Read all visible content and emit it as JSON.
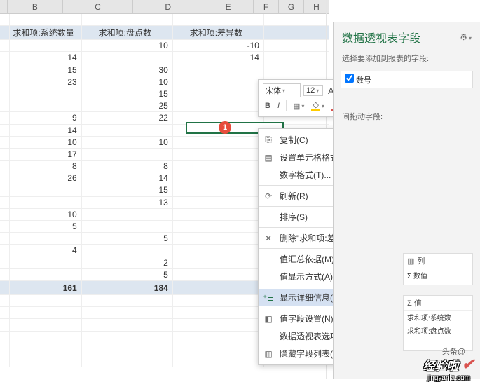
{
  "columns": {
    "B": "B",
    "C": "C",
    "D": "D",
    "E": "E",
    "F": "F",
    "G": "G",
    "H": "H"
  },
  "headers": {
    "b": "求和项:系统数量",
    "c": "求和项:盘点数",
    "d": "求和项:差异数"
  },
  "rows": [
    {
      "b": "",
      "c": "10",
      "d": "-10"
    },
    {
      "b": "14",
      "c": "",
      "d": "14"
    },
    {
      "b": "15",
      "c": "30",
      "d": ""
    },
    {
      "b": "23",
      "c": "10",
      "d": ""
    },
    {
      "b": "",
      "c": "15",
      "d": ""
    },
    {
      "b": "",
      "c": "25",
      "d": ""
    },
    {
      "b": "9",
      "c": "22",
      "d": ""
    },
    {
      "b": "14",
      "c": "",
      "d": ""
    },
    {
      "b": "10",
      "c": "10",
      "d": ""
    },
    {
      "b": "17",
      "c": "",
      "d": ""
    },
    {
      "b": "8",
      "c": "8",
      "d": ""
    },
    {
      "b": "26",
      "c": "14",
      "d": ""
    },
    {
      "b": "",
      "c": "15",
      "d": ""
    },
    {
      "b": "",
      "c": "13",
      "d": ""
    },
    {
      "b": "10",
      "c": "",
      "d": ""
    },
    {
      "b": "5",
      "c": "",
      "d": ""
    },
    {
      "b": "",
      "c": "5",
      "d": ""
    },
    {
      "b": "4",
      "c": "",
      "d": ""
    },
    {
      "b": "",
      "c": "2",
      "d": ""
    },
    {
      "b": "",
      "c": "5",
      "d": ""
    }
  ],
  "totals": {
    "b": "161",
    "c": "184",
    "d": ""
  },
  "mini_toolbar": {
    "font": "宋体",
    "size": "12",
    "bold": "B",
    "italic": "I",
    "percent": "%",
    "comma": ",",
    "a_large": "A",
    "a_small": "A"
  },
  "context": {
    "copy": "复制(C)",
    "format_cells": "设置单元格格式(F)...",
    "number_format": "数字格式(T)...",
    "refresh": "刷新(R)",
    "sort": "排序(S)",
    "delete": "删除\"求和项:差异数\"(V)",
    "summarize": "值汇总依据(M)",
    "show_as": "值显示方式(A)",
    "show_detail": "显示详细信息(E)",
    "field_settings": "值字段设置(N)...",
    "pivot_options": "数据透视表选项(O)...",
    "hide_list": "隐藏字段列表(D)"
  },
  "pane": {
    "title": "数据透视表字段",
    "subtitle": "选择要添加到报表的字段:",
    "checkbox_label": "数号",
    "drag_label": "间拖动字段:",
    "cols_title": "列",
    "cols_item": "Σ 数值",
    "vals_title": "Σ 值",
    "vals_item1": "求和项:系统数",
    "vals_item2": "求和项:盘点数"
  },
  "watermark": {
    "text": "经验啦",
    "domain": "jingyanla.com",
    "handle": "头条@｜"
  },
  "chart_data": {
    "type": "table",
    "title": "数据透视表",
    "columns": [
      "求和项:系统数量",
      "求和项:盘点数",
      "求和项:差异数"
    ],
    "data": [
      [
        null,
        10,
        -10
      ],
      [
        14,
        null,
        14
      ],
      [
        15,
        30,
        null
      ],
      [
        23,
        10,
        null
      ],
      [
        null,
        15,
        null
      ],
      [
        null,
        25,
        null
      ],
      [
        9,
        22,
        null
      ],
      [
        14,
        null,
        null
      ],
      [
        10,
        10,
        null
      ],
      [
        17,
        null,
        null
      ],
      [
        8,
        8,
        null
      ],
      [
        26,
        14,
        null
      ],
      [
        null,
        15,
        null
      ],
      [
        null,
        13,
        null
      ],
      [
        10,
        null,
        null
      ],
      [
        5,
        null,
        null
      ],
      [
        null,
        5,
        null
      ],
      [
        4,
        null,
        null
      ],
      [
        null,
        2,
        null
      ],
      [
        null,
        5,
        null
      ]
    ],
    "totals": [
      161,
      184,
      null
    ]
  }
}
